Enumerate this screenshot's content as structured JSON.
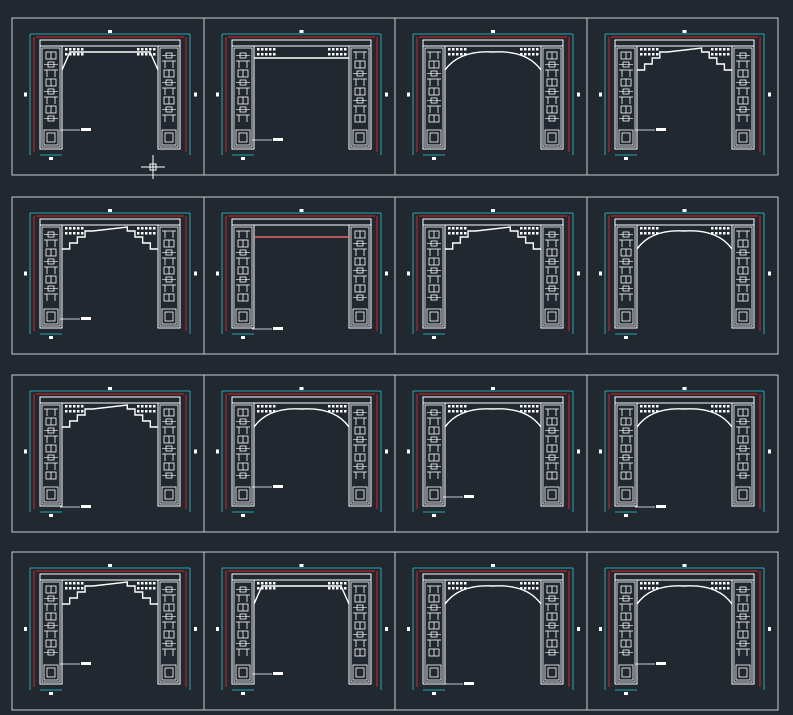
{
  "colors": {
    "background": "#212830",
    "frame": "#c8ccd0",
    "panel": "#ffffff",
    "dim_red": "#e02020",
    "dim_cyan": "#20d0d8"
  },
  "sheet": {
    "rows": 4,
    "cols": 4,
    "cursor_icon": "crosshair-cursor-icon",
    "drawings": [
      {
        "arch": "flat-fret",
        "callout": true
      },
      {
        "arch": "fret-beam",
        "callout": true
      },
      {
        "arch": "round-lattice",
        "callout": false
      },
      {
        "arch": "stepped-right",
        "callout": true
      },
      {
        "arch": "fret-step",
        "callout": true
      },
      {
        "arch": "beam",
        "callout": true
      },
      {
        "arch": "stepped",
        "callout": false
      },
      {
        "arch": "round-lattice",
        "callout": false
      },
      {
        "arch": "half-fret",
        "callout": true
      },
      {
        "arch": "round-notch",
        "callout": true
      },
      {
        "arch": "round-lattice",
        "callout": true
      },
      {
        "arch": "round",
        "callout": true
      },
      {
        "arch": "stepped",
        "callout": true
      },
      {
        "arch": "fret",
        "callout": true
      },
      {
        "arch": "round",
        "callout": true
      },
      {
        "arch": "round-lattice",
        "callout": true
      }
    ]
  }
}
